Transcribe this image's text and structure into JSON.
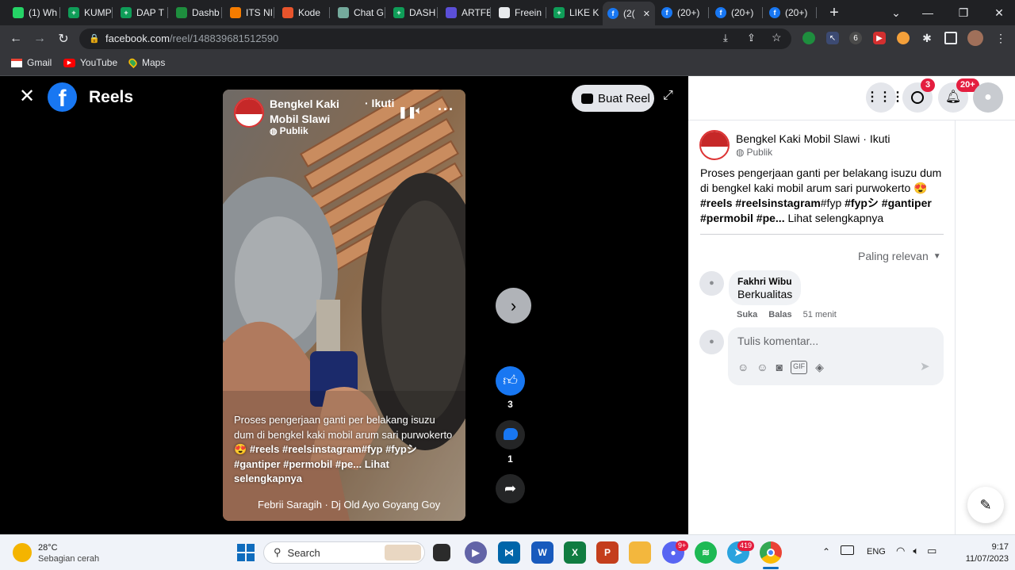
{
  "browser": {
    "tabs": [
      {
        "label": "(1) Wh",
        "icon": "whatsapp-icon",
        "color": "#25d366"
      },
      {
        "label": "KUMP",
        "icon": "sheets-icon",
        "color": "#0f9d58"
      },
      {
        "label": "DAP T",
        "icon": "sheets-icon",
        "color": "#0f9d58"
      },
      {
        "label": "Dashb",
        "icon": "dot-icon",
        "color": "#1e8e3e"
      },
      {
        "label": "ITS NI",
        "icon": "its-icon",
        "color": "#f57c00"
      },
      {
        "label": "Kode",
        "icon": "kode-icon",
        "color": "#e8542c"
      },
      {
        "label": "Chat G",
        "icon": "chatgpt-icon",
        "color": "#74aa9c"
      },
      {
        "label": "DASH",
        "icon": "sheets-icon",
        "color": "#0f9d58"
      },
      {
        "label": "ARTFE",
        "icon": "artfe-icon",
        "color": "#5b4fd8"
      },
      {
        "label": "Freein",
        "icon": "freein-icon",
        "color": "#e8eaed"
      },
      {
        "label": "LIKE K",
        "icon": "sheets-icon",
        "color": "#0f9d58"
      },
      {
        "label": "(2(",
        "icon": "facebook-icon",
        "color": "#1877f2"
      },
      {
        "label": "(20+)",
        "icon": "facebook-icon",
        "color": "#1877f2"
      },
      {
        "label": "(20+)",
        "icon": "facebook-icon",
        "color": "#1877f2"
      },
      {
        "label": "(20+)",
        "icon": "facebook-icon",
        "color": "#1877f2"
      }
    ],
    "new_tab": "+",
    "url_host": "facebook.com",
    "url_path": "/reel/148839681512590",
    "bookmarks": [
      {
        "label": "Gmail",
        "icon": "gmail-icon"
      },
      {
        "label": "YouTube",
        "icon": "youtube-icon"
      },
      {
        "label": "Maps",
        "icon": "maps-icon"
      }
    ]
  },
  "reels": {
    "title": "Reels",
    "create_button": "Buat Reel",
    "author_line1": "Bengkel Kaki",
    "author_line2": "Mobil Slawi",
    "follow": "· Ikuti",
    "visibility": "Publik",
    "caption_plain": "Proses pengerjaan ganti per belakang isuzu dum di bengkel kaki mobil arum sari purwokerto",
    "caption_emoji": "😍",
    "caption_tags": "#reels #reelsinstagram#fyp #fypシ #gantiper #permobil #pe...",
    "caption_more": "Lihat selengkapnya",
    "music": "Febrii Saragih · Dj Old Ayo Goyang Goy",
    "likes": "3",
    "comments": "1"
  },
  "header": {
    "messenger_badge": "3",
    "notif_badge": "20+"
  },
  "panel": {
    "author": "Bengkel Kaki Mobil Slawi",
    "follow": "· Ikuti",
    "visibility": "Publik",
    "caption_plain": "Proses pengerjaan ganti per belakang isuzu dum di bengkel kaki mobil arum sari purwokerto",
    "caption_emoji": "😍",
    "tags_a": "#reels #reelsinstagram",
    "tags_b": "#fyp ",
    "tags_c": "#fypシ #gantiper #permobil #pe...",
    "caption_more": "Lihat selengkapnya",
    "sort": "Paling relevan",
    "comment_author": "Fakhri Wibu",
    "comment_text": "Berkualitas",
    "comment_like": "Suka",
    "comment_reply": "Balas",
    "comment_time": "51 menit",
    "input_placeholder": "Tulis komentar..."
  },
  "taskbar": {
    "weather_temp": "28°C",
    "weather_desc": "Sebagian cerah",
    "search": "Search",
    "discord_badge": "9+",
    "telegram_badge": "419",
    "lang": "ENG",
    "time": "9:17",
    "date": "11/07/2023"
  },
  "colors": {
    "facebook_blue": "#1877f2",
    "badge_red": "#e41e3f"
  }
}
